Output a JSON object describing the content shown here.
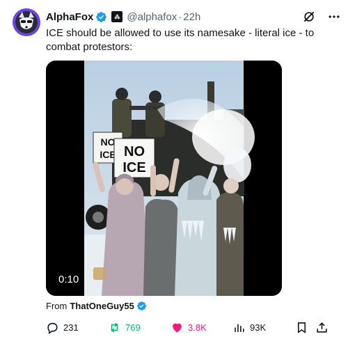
{
  "post": {
    "author_name": "AlphaFox",
    "handle": "@alphafox",
    "separator": "·",
    "time": "22h",
    "affiliate_badge": "⁂",
    "text": "ICE should be allowed to use its namesake - literal ice - to combat protestors:"
  },
  "media": {
    "duration": "0:10",
    "sign_text": "NO ICE",
    "sign_text_back": "NO ICE"
  },
  "source": {
    "label": "From",
    "user": "ThatOneGuy55"
  },
  "actions": {
    "replies": "231",
    "reposts": "769",
    "likes": "3.8K",
    "views": "93K"
  },
  "colors": {
    "verified": "#1d9bf0",
    "repost": "#00ba7c",
    "like": "#f91880",
    "muted": "#536471"
  },
  "icons": [
    "verified-badge-icon",
    "grok-icon",
    "more-icon",
    "reply-icon",
    "repost-icon",
    "like-icon",
    "views-icon",
    "bookmark-icon",
    "share-icon"
  ]
}
